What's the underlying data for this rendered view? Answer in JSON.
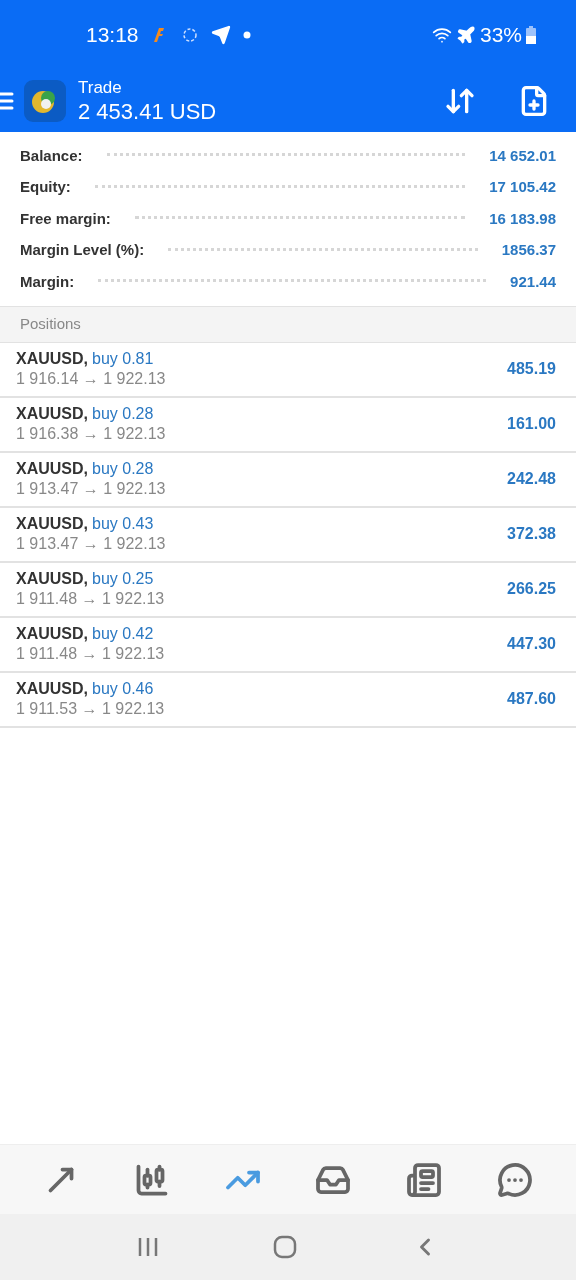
{
  "status_bar": {
    "time": "13:18",
    "battery": "33%"
  },
  "header": {
    "title": "Trade",
    "balance": "2 453.41 USD"
  },
  "summary": [
    {
      "label": "Balance:",
      "value": "14 652.01"
    },
    {
      "label": "Equity:",
      "value": "17 105.42"
    },
    {
      "label": "Free margin:",
      "value": "16 183.98"
    },
    {
      "label": "Margin Level (%):",
      "value": "1856.37"
    },
    {
      "label": "Margin:",
      "value": "921.44"
    }
  ],
  "positions": {
    "title": "Positions",
    "rows": [
      {
        "symbol": "XAUUSD,",
        "side": "buy 0.81",
        "prices": "1 916.14 → 1 922.13",
        "profit": "485.19"
      },
      {
        "symbol": "XAUUSD,",
        "side": "buy 0.28",
        "prices": "1 916.38 → 1 922.13",
        "profit": "161.00"
      },
      {
        "symbol": "XAUUSD,",
        "side": "buy 0.28",
        "prices": "1 913.47 → 1 922.13",
        "profit": "242.48"
      },
      {
        "symbol": "XAUUSD,",
        "side": "buy 0.43",
        "prices": "1 913.47 → 1 922.13",
        "profit": "372.38"
      },
      {
        "symbol": "XAUUSD,",
        "side": "buy 0.25",
        "prices": "1 911.48 → 1 922.13",
        "profit": "266.25"
      },
      {
        "symbol": "XAUUSD,",
        "side": "buy 0.42",
        "prices": "1 911.48 → 1 922.13",
        "profit": "447.30"
      },
      {
        "symbol": "XAUUSD,",
        "side": "buy 0.46",
        "prices": "1 911.53 → 1 922.13",
        "profit": "487.60"
      }
    ]
  },
  "bottom_nav": [
    {
      "kind": "quotes",
      "selected": false
    },
    {
      "kind": "chart",
      "selected": false
    },
    {
      "kind": "trade",
      "selected": true
    },
    {
      "kind": "inbox",
      "selected": false
    },
    {
      "kind": "news",
      "selected": false
    },
    {
      "kind": "chat",
      "selected": false
    }
  ]
}
